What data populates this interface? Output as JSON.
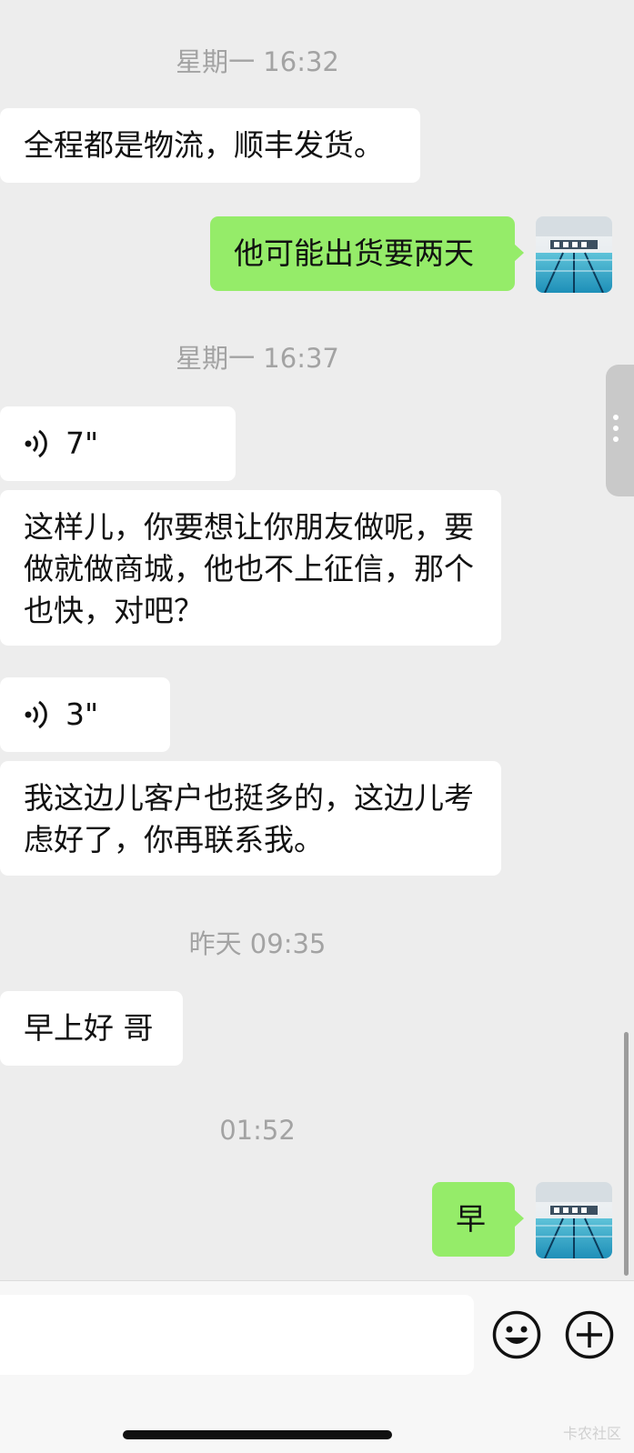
{
  "chat": {
    "ts1": "星期一 16:32",
    "m1": "全程都是物流，顺丰发货。",
    "m2": "他可能出货要两天",
    "ts2": "星期一 16:37",
    "voice1": "7\"",
    "m3": "这样儿，你要想让你朋友做呢，要做就做商城，他也不上征信，那个也快，对吧？",
    "voice2": "3\"",
    "m4": "我这边儿客户也挺多的，这边儿考虑好了，你再联系我。",
    "ts3": "昨天 09:35",
    "m5": "早上好 哥",
    "ts4": "01:52",
    "m6": "早"
  },
  "icons": {
    "voice": "voice-wave-icon",
    "emoji": "emoji-smile-icon",
    "plus": "plus-circle-icon",
    "menu": "vertical-dots-icon"
  },
  "watermark": "卡农社区",
  "colors": {
    "background": "#ededed",
    "incoming_bubble": "#ffffff",
    "outgoing_bubble": "#95ec69",
    "timestamp": "#a3a3a3"
  }
}
